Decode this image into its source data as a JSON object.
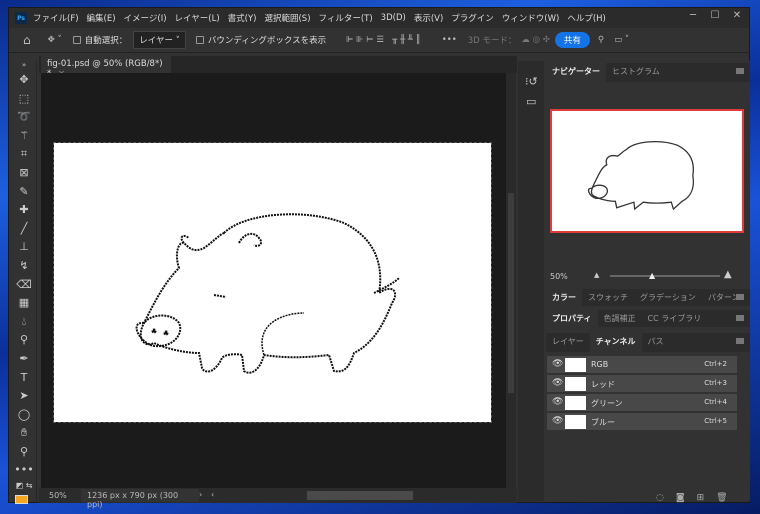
{
  "app": {
    "logo": "Ps",
    "menus": [
      "ファイル(F)",
      "編集(E)",
      "イメージ(I)",
      "レイヤー(L)",
      "書式(Y)",
      "選択範囲(S)",
      "フィルター(T)",
      "3D(D)",
      "表示(V)",
      "プラグイン",
      "ウィンドウ(W)",
      "ヘルプ(H)"
    ],
    "window_buttons": [
      "─",
      "☐",
      "✕"
    ]
  },
  "options": {
    "auto_select_label": "自動選択：",
    "auto_select_value": "レイヤー",
    "bbox_label": "バウンディングボックスを表示",
    "more": "•••",
    "mode_3d": "3D モード：",
    "share": "共有"
  },
  "document": {
    "tab_title": "fig-01.psd @ 50% (RGB/8*) *",
    "close": "×",
    "zoom": "50%",
    "info": "1236 px x 790 px (300 ppi)"
  },
  "colors": {
    "foreground": "#f5a623",
    "accent": "#1473e6",
    "navigator_border": "#e03c3c"
  },
  "panels": {
    "navigator": {
      "tabs": [
        "ナビゲーター",
        "ヒストグラム"
      ],
      "zoom": "50%",
      "zoom_level": 0.5
    },
    "color": {
      "tabs": [
        "カラー",
        "スウォッチ",
        "グラデーション",
        "パターン"
      ]
    },
    "properties": {
      "tabs": [
        "プロパティ",
        "色調補正",
        "CC ライブラリ"
      ]
    },
    "layers": {
      "tabs": [
        "レイヤー",
        "チャンネル",
        "パス"
      ],
      "channels": [
        {
          "name": "RGB",
          "shortcut": "Ctrl+2"
        },
        {
          "name": "レッド",
          "shortcut": "Ctrl+3"
        },
        {
          "name": "グリーン",
          "shortcut": "Ctrl+4"
        },
        {
          "name": "ブルー",
          "shortcut": "Ctrl+5"
        }
      ]
    }
  }
}
